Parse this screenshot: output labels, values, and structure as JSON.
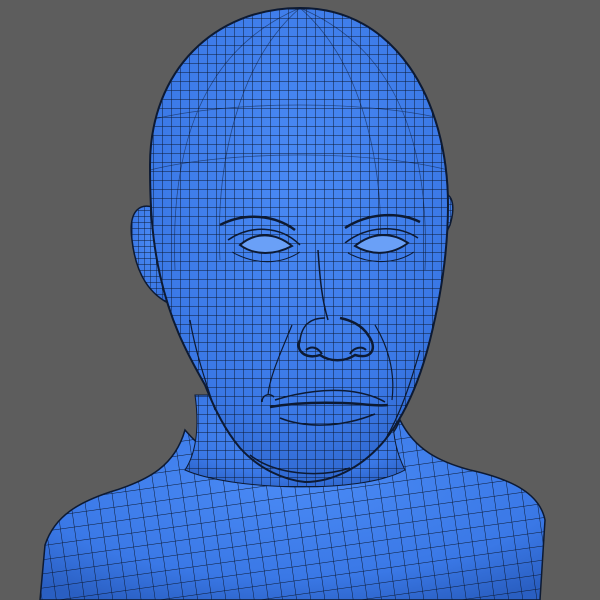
{
  "viewport": {
    "background_color": "#5d5d5d"
  },
  "model": {
    "subject": "head-and-shoulders-bust",
    "display_mode": "wireframe-on-shaded",
    "surface_color": "#3d7be8",
    "wire_color": "#0d1a33"
  }
}
